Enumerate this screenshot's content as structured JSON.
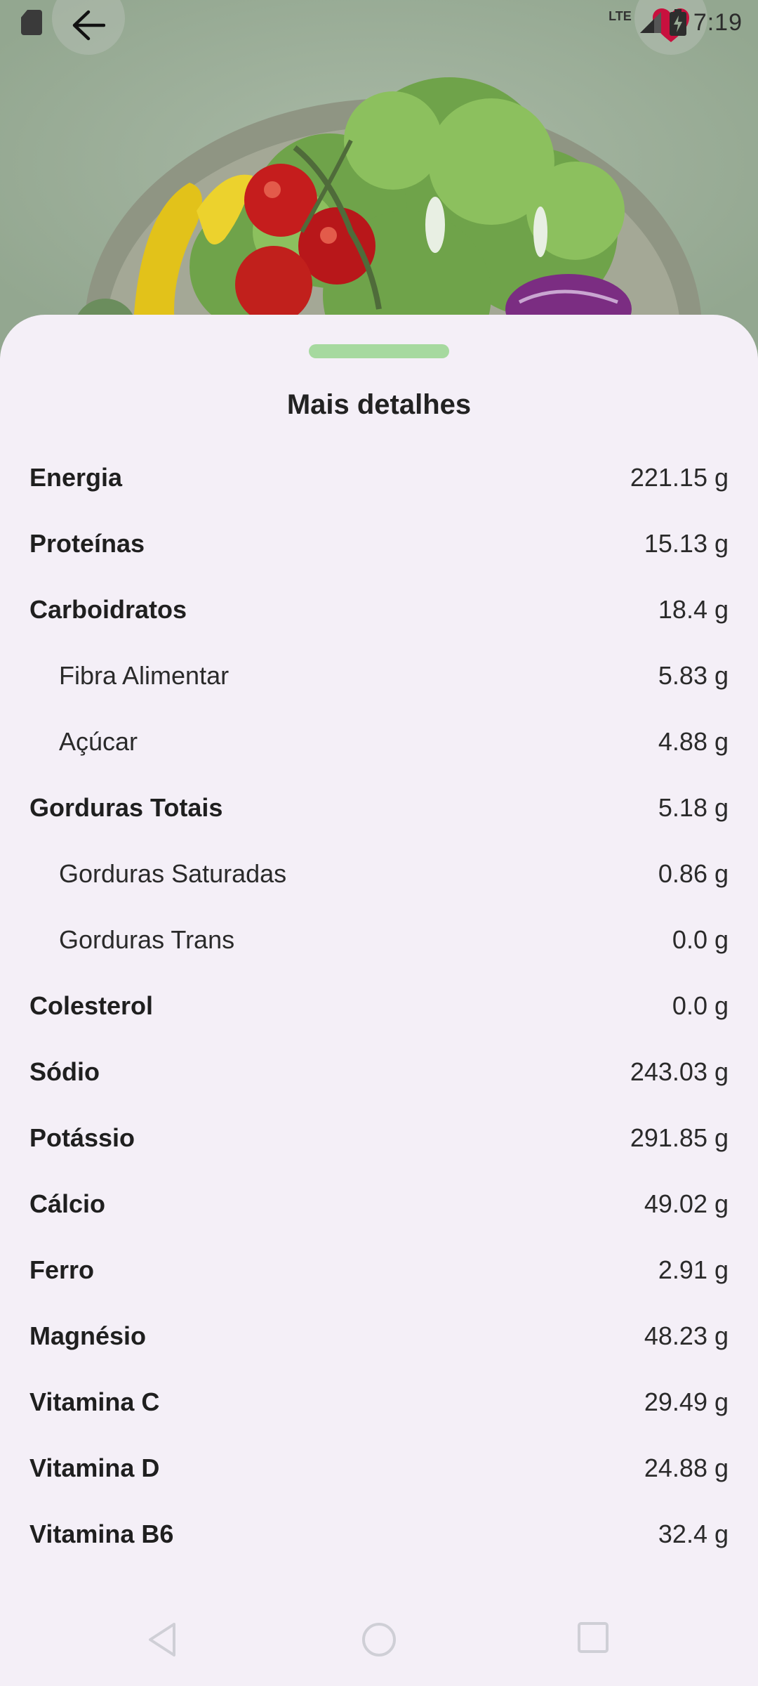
{
  "status_bar": {
    "time": "7:19",
    "network": "LTE",
    "icons": [
      "sd-card-icon",
      "signal-icon",
      "battery-charging-icon"
    ]
  },
  "header": {
    "back_icon": "arrow-left-icon",
    "favorite_icon": "heart-icon",
    "favorite_color": "#c8103e",
    "image": "salad-bowl"
  },
  "sheet": {
    "title": "Mais detalhes",
    "handle_color": "#a6d99f",
    "rows": [
      {
        "label": "Energia",
        "value": "221.15 g",
        "level": "main"
      },
      {
        "label": "Proteínas",
        "value": "15.13 g",
        "level": "main"
      },
      {
        "label": "Carboidratos",
        "value": "18.4 g",
        "level": "main"
      },
      {
        "label": "Fibra Alimentar",
        "value": "5.83 g",
        "level": "sub"
      },
      {
        "label": "Açúcar",
        "value": "4.88 g",
        "level": "sub"
      },
      {
        "label": "Gorduras Totais",
        "value": "5.18 g",
        "level": "main"
      },
      {
        "label": "Gorduras Saturadas",
        "value": "0.86 g",
        "level": "sub"
      },
      {
        "label": "Gorduras Trans",
        "value": "0.0 g",
        "level": "sub"
      },
      {
        "label": "Colesterol",
        "value": "0.0 g",
        "level": "main"
      },
      {
        "label": "Sódio",
        "value": "243.03 g",
        "level": "main"
      },
      {
        "label": "Potássio",
        "value": "291.85 g",
        "level": "main"
      },
      {
        "label": "Cálcio",
        "value": "49.02 g",
        "level": "main"
      },
      {
        "label": "Ferro",
        "value": "2.91 g",
        "level": "main"
      },
      {
        "label": "Magnésio",
        "value": "48.23 g",
        "level": "main"
      },
      {
        "label": "Vitamina C",
        "value": "29.49 g",
        "level": "main"
      },
      {
        "label": "Vitamina D",
        "value": "24.88 g",
        "level": "main"
      },
      {
        "label": "Vitamina B6",
        "value": "32.4 g",
        "level": "main"
      }
    ]
  },
  "nav_bar": {
    "icons": [
      "nav-back-icon",
      "nav-home-icon",
      "nav-recents-icon"
    ]
  }
}
